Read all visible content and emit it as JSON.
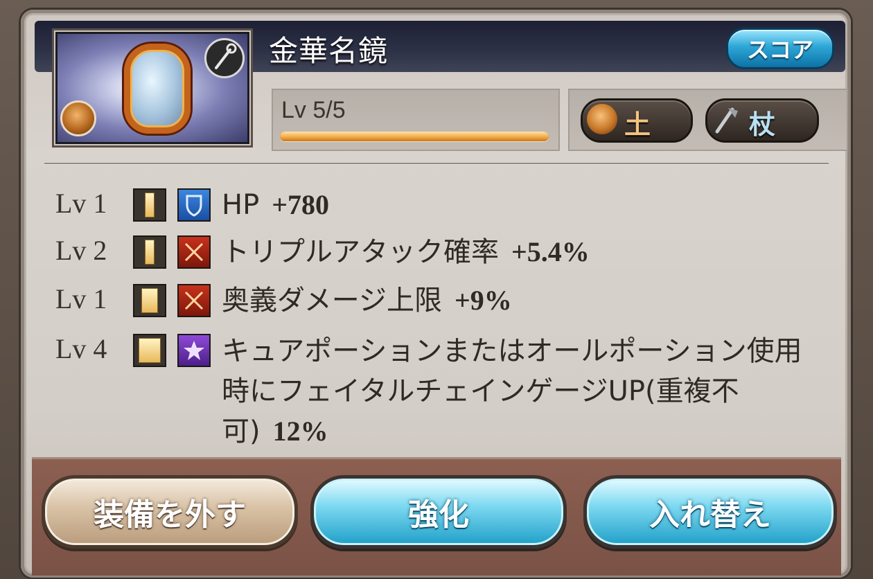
{
  "item": {
    "name": "金華名鏡",
    "score_label": "スコア",
    "level_text": "Lv 5/5",
    "level_progress": 1.0,
    "element_label": "土",
    "weapon_type_label": "杖"
  },
  "skills": [
    {
      "level": "Lv 1",
      "rank": "I",
      "type_icon": "shield-icon",
      "text": "HP",
      "value": "+780"
    },
    {
      "level": "Lv 2",
      "rank": "I",
      "type_icon": "crossed-swords-icon",
      "text": "トリプルアタック確率",
      "value": "+5.4%"
    },
    {
      "level": "Lv 1",
      "rank": "II",
      "type_icon": "crossed-swords-icon",
      "text": "奥義ダメージ上限",
      "value": "+9%"
    },
    {
      "level": "Lv 4",
      "rank": "III",
      "type_icon": "star-icon",
      "text": "キュアポーションまたはオールポーション使用時にフェイタルチェインゲージUP(重複不可)",
      "value": "12%"
    }
  ],
  "buttons": {
    "unequip": "装備を外す",
    "enhance": "強化",
    "swap": "入れ替え"
  },
  "colors": {
    "earth_element": "#c77626",
    "accent_blue": "#2ea6d6",
    "level_bar": "#f0a540"
  }
}
